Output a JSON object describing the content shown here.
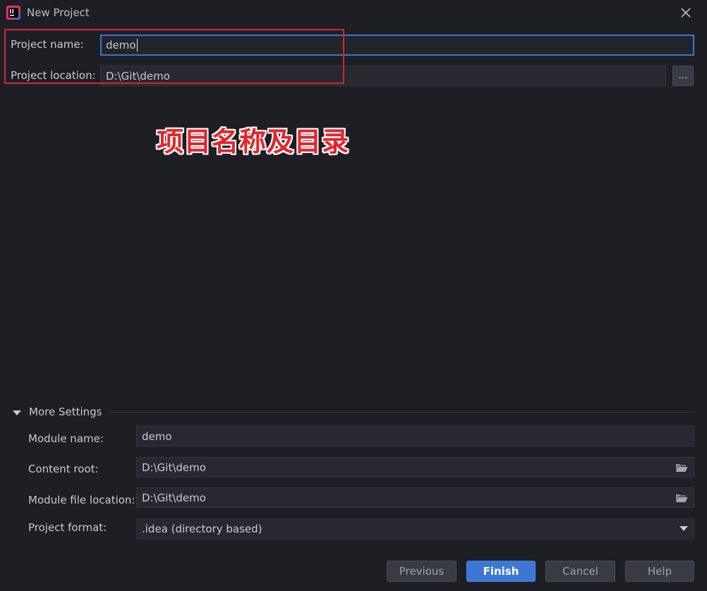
{
  "window": {
    "title": "New Project",
    "app_icon": "intellij-idea-icon",
    "close_icon": "close-icon"
  },
  "project_name": {
    "label": "Project name:",
    "value": "demo"
  },
  "project_location": {
    "label": "Project location:",
    "value": "D:\\Git\\demo",
    "browse_label": "..."
  },
  "annotation": {
    "text": "项目名称及目录",
    "color": "#e8232a"
  },
  "more_settings": {
    "label": "More Settings",
    "expanded": true,
    "module_name": {
      "label": "Module name:",
      "value": "demo"
    },
    "content_root": {
      "label": "Content root:",
      "value": "D:\\Git\\demo"
    },
    "module_file_location": {
      "label": "Module file location:",
      "value": "D:\\Git\\demo"
    },
    "project_format": {
      "label": "Project format:",
      "value": ".idea (directory based)"
    }
  },
  "buttons": {
    "previous": "Previous",
    "finish": "Finish",
    "cancel": "Cancel",
    "help": "Help"
  },
  "colors": {
    "background": "#1e1f25",
    "accent": "#3d77d6",
    "focus_border": "#3d74c8",
    "highlight_border": "#d6262b"
  }
}
